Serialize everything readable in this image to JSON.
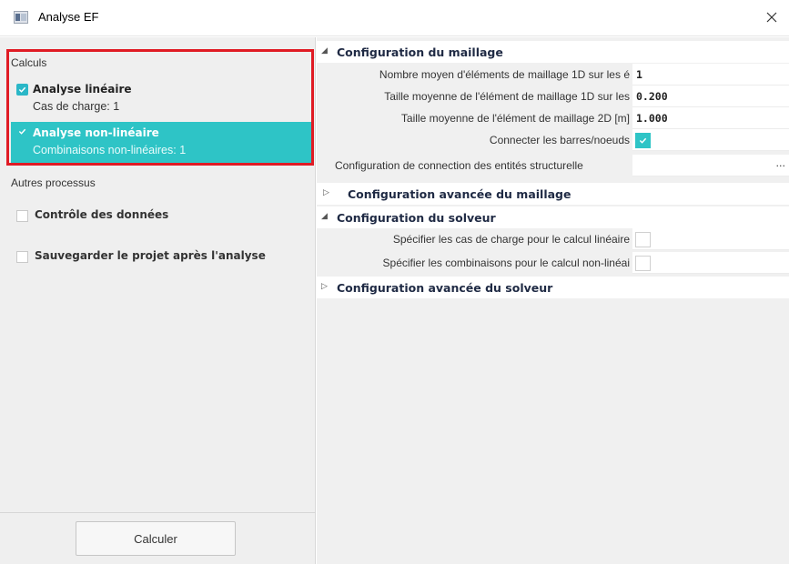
{
  "window": {
    "title": "Analyse EF",
    "icon": "app-window-icon",
    "close_icon": "close-icon"
  },
  "left": {
    "calculs_header": "Calculs",
    "items": [
      {
        "title": "Analyse linéaire",
        "subtitle": "Cas de charge: 1",
        "checked": true,
        "selected": false
      },
      {
        "title": "Analyse non-linéaire",
        "subtitle": "Combinaisons non-linéaires: 1",
        "checked": true,
        "selected": true
      }
    ],
    "other_header": "Autres processus",
    "others": [
      {
        "label": "Contrôle des données",
        "checked": false
      },
      {
        "label": "Sauvegarder le projet après l'analyse",
        "checked": false
      }
    ],
    "calc_button": "Calculer"
  },
  "properties": {
    "mesh_group": "Configuration du maillage",
    "mesh_rows": [
      {
        "label": "Nombre moyen d'éléments de maillage 1D sur les é",
        "value": "1"
      },
      {
        "label": "Taille moyenne de l'élément de maillage 1D sur les",
        "value": "0.200"
      },
      {
        "label": "Taille moyenne de l'élément de maillage 2D [m]",
        "value": "1.000"
      },
      {
        "label": "Connecter les barres/noeuds",
        "checked": true
      },
      {
        "label": "Configuration de connection des entités structurelle",
        "value": "..."
      }
    ],
    "advanced_mesh_group": "Configuration avancée du maillage",
    "solver_group": "Configuration du solveur",
    "solver_rows": [
      {
        "label": "Spécifier les cas de charge pour le calcul linéaire",
        "checked": false
      },
      {
        "label": "Spécifier les combinaisons pour le calcul non-linéai",
        "checked": false
      }
    ],
    "advanced_solver_group": "Configuration avancée du solveur"
  },
  "colors": {
    "accent": "#2ec4c6",
    "highlight_border": "#e01b24"
  }
}
